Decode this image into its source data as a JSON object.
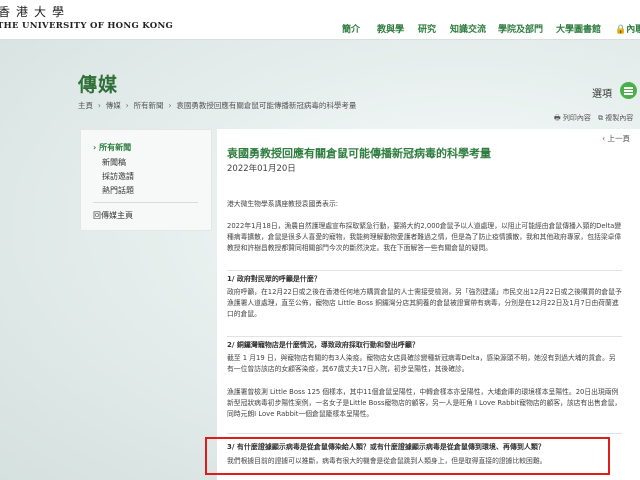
{
  "header": {
    "logo_zh": "香港大學",
    "logo_en": "THE UNIVERSITY OF HONG KONG",
    "nav": [
      {
        "label": "簡介"
      },
      {
        "label": "教與學"
      },
      {
        "label": "研究"
      },
      {
        "label": "知識交流"
      },
      {
        "label": "學院及部門"
      },
      {
        "label": "大學圖書館"
      },
      {
        "label": "內聯"
      }
    ],
    "accent": "#2f7d3f"
  },
  "page": {
    "title": "傳媒",
    "breadcrumb": [
      "主頁",
      "傳媒",
      "所有新聞",
      "袁國勇教授回應有關倉鼠可能傳播新冠病毒的科學考量"
    ],
    "select_label": "選項",
    "print_label": "列印內容",
    "copy_label": "複製內容"
  },
  "sidebar": {
    "items": [
      {
        "label": "所有新聞",
        "active": true
      },
      {
        "label": "新聞稿"
      },
      {
        "label": "採訪邀請"
      },
      {
        "label": "熱門話題"
      }
    ],
    "back_to_media": "回傳媒主頁"
  },
  "article": {
    "back": "上一頁",
    "title": "袁國勇教授回應有關倉鼠可能傳播新冠病毒的科學考量",
    "date": "2022年01月20日",
    "intro": "港大微生物學系講座教授袁國勇表示:",
    "p1": "2022年1月18日，漁農自然護理處宣布採取緊急行動，要將大約2,000倉鼠予以人道處理，以阻止可能經由倉鼠傳播入頸的Delta變種病毒擴散，倉鼠是很多人喜愛的寵物，我能夠理解動物愛護者難過之情，但是為了防止疫情擴散，我和其他政府專家，包括梁卓偉教授和許樹昌教授都贊同相關部門今次的斷然決定。我在下面解答一些有關倉鼠的疑問。",
    "q1": "1/ 政府對民眾的呼籲是什麼？",
    "a1": "政府呼籲，在12月22日或之後在香港任何地方購買倉鼠的人士需接受檢測，另「強烈建議」市民交出12月22日或之後購買的倉鼠予漁護署人道處理，直至公佈，寵物店 Little Boss 銅鑼灣分店其飼養的倉鼠被證實帶有病毒，分別是在12月22日及1月7日由荷蘭進口的倉鼠。",
    "q2": "2/ 銅鑼灣寵物店是什麼情況，導致政府採取行動和發出呼籲？",
    "a2": "截至 1 月19 日，與寵物店有關的有3人染疫。寵物店女店員確診變種新冠病毒Delta，感染源頭不明，她沒有到過大埔的貨倉。另有一位曾訪該店的女顧客染疫，其67歲丈夫17日入院，初步呈陽性，其後確診。",
    "a2b": "漁護署曾檢測 Little Boss 125 個樣本，其中11個倉鼠呈陽性，中轉倉樣本亦呈陽性，大埔倉庫的環境樣本呈陽性。20日出現兩例新型冠狀病毒初步陽性案例，一名女子是Little Boss寵物店的顧客，另一人是旺角 I Love Rabbit寵物店的顧客，該店有出售倉鼠，同時元朗I Love Rabbit一個倉鼠籠樣本呈陽性。",
    "q3": "3/ 有什麼證據顯示病毒是從倉鼠傳染給人類？或有什麼證據顯示病毒是從倉鼠傳到環境、再傳到人類？",
    "a3": "我們根據目前的證據可以推斷，病毒有很大的機會是從倉鼠跳到人類身上，但是取得直接的證據比較困難。"
  }
}
